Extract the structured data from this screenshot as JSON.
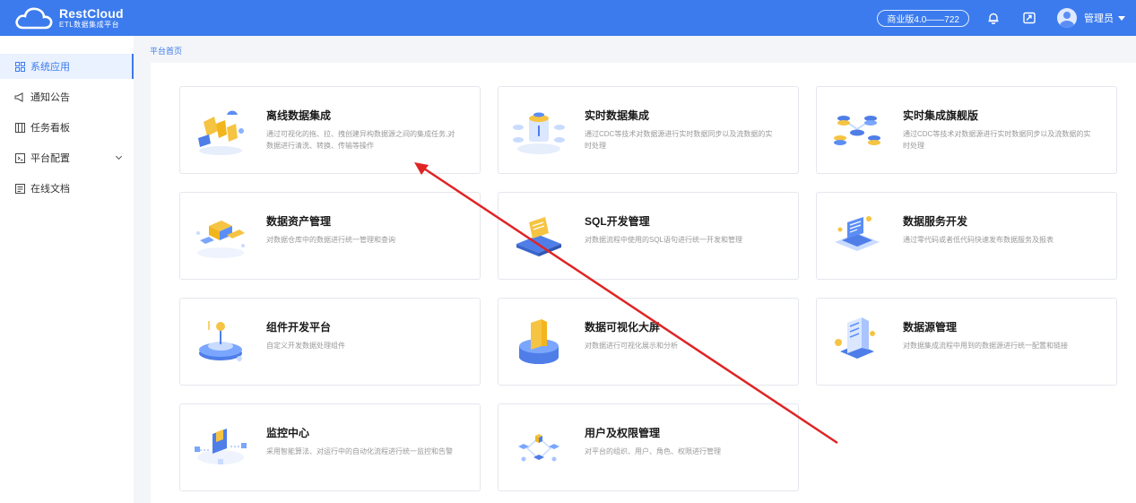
{
  "header": {
    "logo_title": "RestCloud",
    "logo_subtitle": "ETL数据集成平台",
    "version": "商业版4.0——722",
    "user_name": "管理员"
  },
  "sidebar": {
    "items": [
      {
        "label": "系统应用",
        "icon": "grid-icon",
        "active": true
      },
      {
        "label": "通知公告",
        "icon": "megaphone-icon",
        "active": false
      },
      {
        "label": "任务看板",
        "icon": "board-icon",
        "active": false
      },
      {
        "label": "平台配置",
        "icon": "config-icon",
        "active": false,
        "expandable": true
      },
      {
        "label": "在线文档",
        "icon": "document-icon",
        "active": false
      }
    ]
  },
  "breadcrumb": "平台首页",
  "cards": [
    {
      "title": "离线数据集成",
      "desc": "通过可视化的拖、拉、拽创建异构数据源之间的集成任务,对数据进行清洗、转换、传输等操作"
    },
    {
      "title": "实时数据集成",
      "desc": "通过CDC等技术对数据源进行实时数据同步以及流数据的实时处理"
    },
    {
      "title": "实时集成旗舰版",
      "desc": "通过CDC等技术对数据源进行实时数据同步以及流数据的实时处理"
    },
    {
      "title": "数据资产管理",
      "desc": "对数据仓库中的数据进行统一管理和查询"
    },
    {
      "title": "SQL开发管理",
      "desc": "对数据流程中使用的SQL语句进行统一开发和管理"
    },
    {
      "title": "数据服务开发",
      "desc": "通过零代码或者低代码快速发布数据服务及报表"
    },
    {
      "title": "组件开发平台",
      "desc": "自定义开发数据处理组件"
    },
    {
      "title": "数据可视化大屏",
      "desc": "对数据进行可视化展示和分析"
    },
    {
      "title": "数据源管理",
      "desc": "对数据集成流程中用到的数据源进行统一配置和链接"
    },
    {
      "title": "监控中心",
      "desc": "采用智能算法、对运行中的自动化流程进行统一监控和告警"
    },
    {
      "title": "用户及权限管理",
      "desc": "对平台的组织、用户、角色、权限进行管理"
    }
  ],
  "colors": {
    "brand": "#3b7bed",
    "annotation_arrow": "#e02424"
  }
}
